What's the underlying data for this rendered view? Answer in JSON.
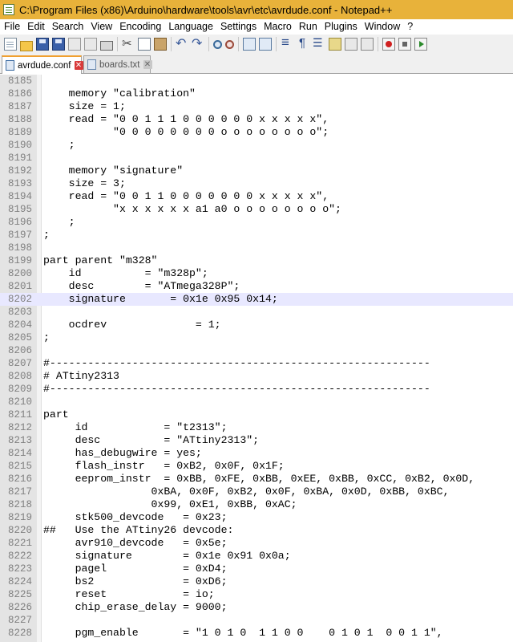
{
  "window": {
    "title": "C:\\Program Files (x86)\\Arduino\\hardware\\tools\\avr\\etc\\avrdude.conf - Notepad++"
  },
  "menu": [
    "File",
    "Edit",
    "Search",
    "View",
    "Encoding",
    "Language",
    "Settings",
    "Macro",
    "Run",
    "Plugins",
    "Window",
    "?"
  ],
  "toolbar": {
    "icons": [
      "new-file-icon",
      "open-folder-icon",
      "save-icon",
      "save-all-icon",
      "close-file-icon",
      "close-all-icon",
      "print-icon",
      "cut-icon",
      "copy-icon",
      "paste-icon",
      "undo-icon",
      "redo-icon",
      "find-icon",
      "replace-icon",
      "zoom-in-icon",
      "zoom-out-icon",
      "sync-vertical-icon",
      "sync-horizontal-icon",
      "word-wrap-icon",
      "show-all-chars-icon",
      "indent-guide-icon",
      "language-icon",
      "doc-map-icon",
      "function-list-icon",
      "record-macro-icon",
      "stop-record-icon",
      "play-macro-icon"
    ]
  },
  "tabs": [
    {
      "label": "avrdude.conf",
      "active": true
    },
    {
      "label": "boards.txt",
      "active": false
    }
  ],
  "editor": {
    "current_line": "8202",
    "lines": [
      {
        "n": "8185",
        "text": ""
      },
      {
        "n": "8186",
        "text": "    memory \"calibration\""
      },
      {
        "n": "8187",
        "text": "    size = 1;"
      },
      {
        "n": "8188",
        "text": "    read = \"0 0 1 1 1 0 0 0 0 0 0 x x x x x\","
      },
      {
        "n": "8189",
        "text": "           \"0 0 0 0 0 0 0 0 o o o o o o o o\";"
      },
      {
        "n": "8190",
        "text": "    ;"
      },
      {
        "n": "8191",
        "text": ""
      },
      {
        "n": "8192",
        "text": "    memory \"signature\""
      },
      {
        "n": "8193",
        "text": "    size = 3;"
      },
      {
        "n": "8194",
        "text": "    read = \"0 0 1 1 0 0 0 0 0 0 0 x x x x x\","
      },
      {
        "n": "8195",
        "text": "           \"x x x x x x a1 a0 o o o o o o o o\";"
      },
      {
        "n": "8196",
        "text": "    ;"
      },
      {
        "n": "8197",
        "text": ";"
      },
      {
        "n": "8198",
        "text": ""
      },
      {
        "n": "8199",
        "text": "part parent \"m328\""
      },
      {
        "n": "8200",
        "text": "    id          = \"m328p\";"
      },
      {
        "n": "8201",
        "text": "    desc        = \"ATmega328P\";"
      },
      {
        "n": "8202",
        "text": "    signature       = 0x1e 0x95 0x14;"
      },
      {
        "n": "8203",
        "text": ""
      },
      {
        "n": "8204",
        "text": "    ocdrev              = 1;"
      },
      {
        "n": "8205",
        "text": ";"
      },
      {
        "n": "8206",
        "text": ""
      },
      {
        "n": "8207",
        "text": "#------------------------------------------------------------"
      },
      {
        "n": "8208",
        "text": "# ATtiny2313"
      },
      {
        "n": "8209",
        "text": "#------------------------------------------------------------"
      },
      {
        "n": "8210",
        "text": ""
      },
      {
        "n": "8211",
        "text": "part"
      },
      {
        "n": "8212",
        "text": "     id            = \"t2313\";"
      },
      {
        "n": "8213",
        "text": "     desc          = \"ATtiny2313\";"
      },
      {
        "n": "8214",
        "text": "     has_debugwire = yes;"
      },
      {
        "n": "8215",
        "text": "     flash_instr   = 0xB2, 0x0F, 0x1F;"
      },
      {
        "n": "8216",
        "text": "     eeprom_instr  = 0xBB, 0xFE, 0xBB, 0xEE, 0xBB, 0xCC, 0xB2, 0x0D,"
      },
      {
        "n": "8217",
        "text": "                 0xBA, 0x0F, 0xB2, 0x0F, 0xBA, 0x0D, 0xBB, 0xBC,"
      },
      {
        "n": "8218",
        "text": "                 0x99, 0xE1, 0xBB, 0xAC;"
      },
      {
        "n": "8219",
        "text": "     stk500_devcode   = 0x23;"
      },
      {
        "n": "8220",
        "text": "##   Use the ATtiny26 devcode:"
      },
      {
        "n": "8221",
        "text": "     avr910_devcode   = 0x5e;"
      },
      {
        "n": "8222",
        "text": "     signature        = 0x1e 0x91 0x0a;"
      },
      {
        "n": "8223",
        "text": "     pagel            = 0xD4;"
      },
      {
        "n": "8224",
        "text": "     bs2              = 0xD6;"
      },
      {
        "n": "8225",
        "text": "     reset            = io;"
      },
      {
        "n": "8226",
        "text": "     chip_erase_delay = 9000;"
      },
      {
        "n": "8227",
        "text": ""
      },
      {
        "n": "8228",
        "text": "     pgm_enable       = \"1 0 1 0  1 1 0 0    0 1 0 1  0 0 1 1\","
      }
    ]
  }
}
